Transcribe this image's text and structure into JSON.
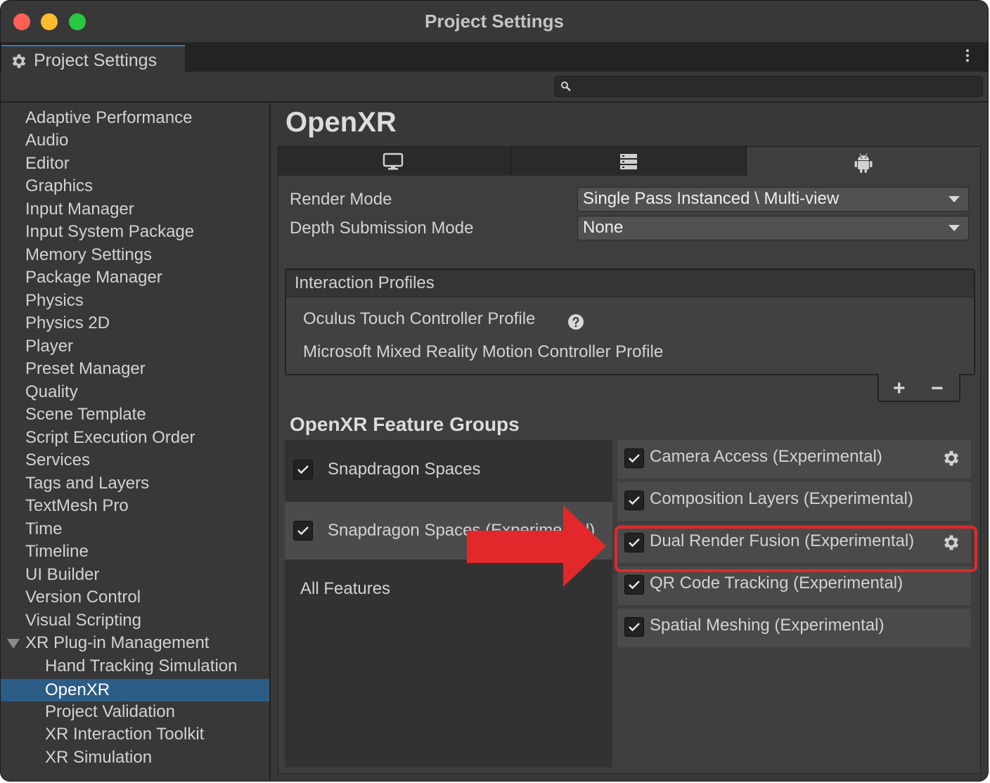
{
  "window": {
    "title": "Project Settings"
  },
  "tab": {
    "label": "Project Settings",
    "icon": "gear-icon"
  },
  "search": {
    "placeholder": ""
  },
  "sidebar": {
    "items": [
      {
        "label": "Adaptive Performance"
      },
      {
        "label": "Audio"
      },
      {
        "label": "Editor"
      },
      {
        "label": "Graphics"
      },
      {
        "label": "Input Manager"
      },
      {
        "label": "Input System Package"
      },
      {
        "label": "Memory Settings"
      },
      {
        "label": "Package Manager"
      },
      {
        "label": "Physics"
      },
      {
        "label": "Physics 2D"
      },
      {
        "label": "Player"
      },
      {
        "label": "Preset Manager"
      },
      {
        "label": "Quality"
      },
      {
        "label": "Scene Template"
      },
      {
        "label": "Script Execution Order"
      },
      {
        "label": "Services"
      },
      {
        "label": "Tags and Layers"
      },
      {
        "label": "TextMesh Pro"
      },
      {
        "label": "Time"
      },
      {
        "label": "Timeline"
      },
      {
        "label": "UI Builder"
      },
      {
        "label": "Version Control"
      },
      {
        "label": "Visual Scripting"
      },
      {
        "label": "XR Plug-in Management",
        "expanded": true
      },
      {
        "label": "Hand Tracking Simulation",
        "child": true
      },
      {
        "label": "OpenXR",
        "child": true,
        "selected": true
      },
      {
        "label": "Project Validation",
        "child": true
      },
      {
        "label": "XR Interaction Toolkit",
        "child": true
      },
      {
        "label": "XR Simulation",
        "child": true
      }
    ]
  },
  "main": {
    "title": "OpenXR",
    "platform_tabs": [
      {
        "icon": "monitor-icon"
      },
      {
        "icon": "server-rack-icon"
      },
      {
        "icon": "android-icon",
        "active": true
      }
    ],
    "render_mode": {
      "label": "Render Mode",
      "value": "Single Pass Instanced \\ Multi-view"
    },
    "depth_mode": {
      "label": "Depth Submission Mode",
      "value": "None"
    },
    "profiles": {
      "title": "Interaction Profiles",
      "items": [
        {
          "label": "Oculus Touch Controller Profile"
        },
        {
          "label": "Microsoft Mixed Reality Motion Controller Profile"
        }
      ],
      "add_label": "+",
      "remove_label": "−"
    },
    "groups_title": "OpenXR Feature Groups",
    "groups": [
      {
        "label": "Snapdragon Spaces",
        "checked": true
      },
      {
        "label": "Snapdragon Spaces (Experimental)",
        "checked": true,
        "selected": true
      },
      {
        "label": "All Features"
      }
    ],
    "features": [
      {
        "label": "Camera Access (Experimental)",
        "checked": true,
        "gear": true
      },
      {
        "label": "Composition Layers (Experimental)",
        "checked": true,
        "gear": false
      },
      {
        "label": "Dual Render Fusion (Experimental)",
        "checked": true,
        "gear": true,
        "highlighted": true
      },
      {
        "label": "QR Code Tracking (Experimental)",
        "checked": true,
        "gear": false
      },
      {
        "label": "Spatial Meshing (Experimental)",
        "checked": true,
        "gear": false
      }
    ]
  },
  "annotation": {
    "highlight_color": "#e3282c"
  },
  "colors": {
    "selection": "#2c5d87",
    "accent_tab": "#3a79bb"
  }
}
